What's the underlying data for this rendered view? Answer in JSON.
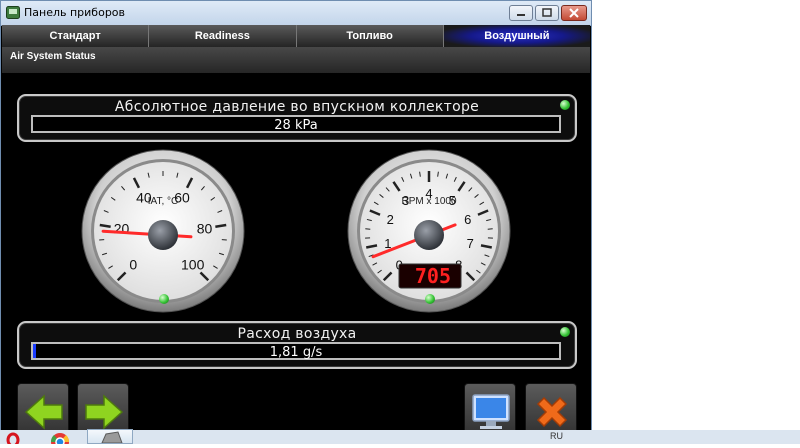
{
  "window": {
    "title": "Панель приборов"
  },
  "tabs": [
    {
      "label": "Стандарт",
      "active": false
    },
    {
      "label": "Readiness",
      "active": false
    },
    {
      "label": "Топливо",
      "active": false
    },
    {
      "label": "Воздушный",
      "active": true
    }
  ],
  "section": {
    "title": "Air System Status"
  },
  "map_panel": {
    "label": "Абсолютное давление во впускном коллекторе",
    "value": "28 kPa",
    "status_led": "green"
  },
  "iat_gauge": {
    "caption": "IAT, °C",
    "ticks": [
      "0",
      "20",
      "40",
      "60",
      "80",
      "100"
    ],
    "min": 0,
    "max": 100,
    "value": 18,
    "status_led": "green"
  },
  "rpm_gauge": {
    "caption": "RPM x 1000",
    "ticks": [
      "0",
      "1",
      "2",
      "3",
      "4",
      "5",
      "6",
      "7",
      "8"
    ],
    "min": 0,
    "max": 8,
    "value": 0.705,
    "digital_readout": "705",
    "status_led": "green"
  },
  "airflow_panel": {
    "label": "Расход воздуха",
    "value": "1,81 g/s",
    "bar_fraction": 0.005,
    "status_led": "green"
  },
  "buttons": {
    "back": "arrow-left-icon",
    "forward": "arrow-right-icon",
    "monitor": "monitor-icon",
    "close": "close-x-icon"
  },
  "taskbar": {
    "language": "RU"
  },
  "colors": {
    "active_tab": "#1a1fb0",
    "led_green": "#35c435",
    "needle_red": "#ff2a2a",
    "digital_red": "#ff2020",
    "nav_arrow_green": "#8fd420",
    "close_orange": "#f06a1a"
  }
}
